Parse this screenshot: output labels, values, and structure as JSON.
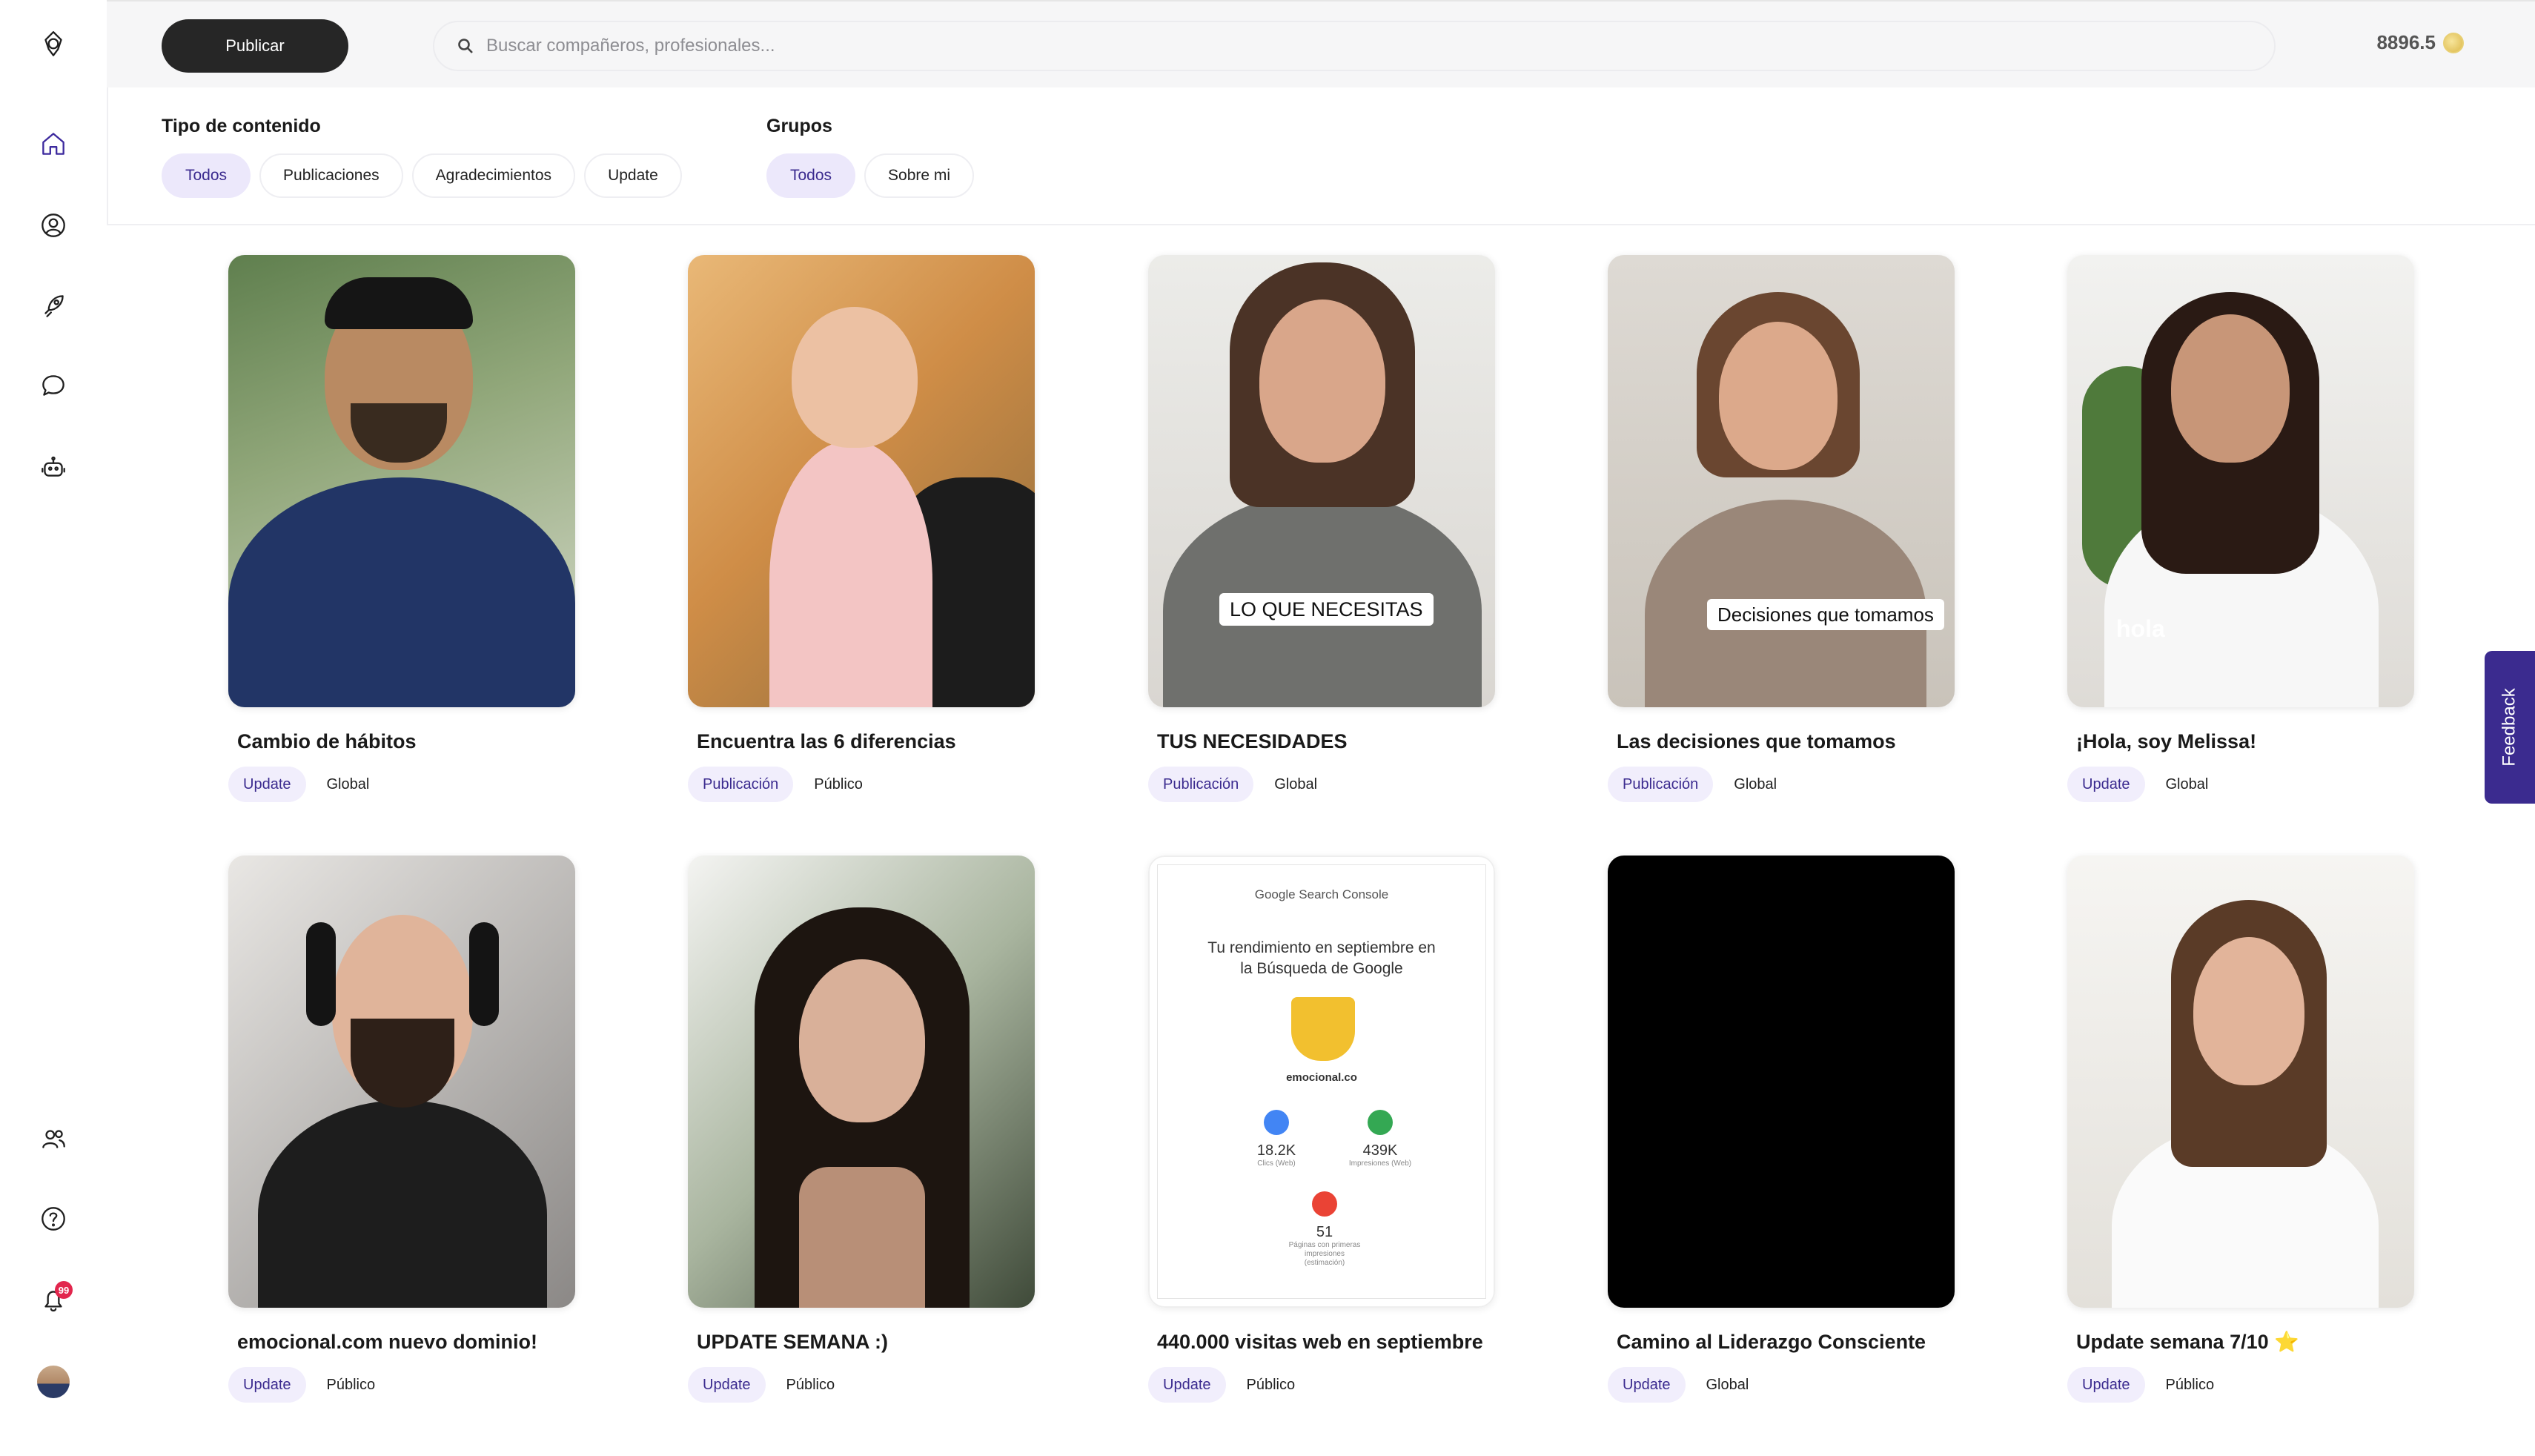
{
  "topbar": {
    "publish_label": "Publicar",
    "search_placeholder": "Buscar compañeros, profesionales...",
    "coins": "8896.5"
  },
  "notifications": {
    "badge": "99"
  },
  "filters": {
    "content_type": {
      "title": "Tipo de contenido",
      "options": [
        "Todos",
        "Publicaciones",
        "Agradecimientos",
        "Update"
      ],
      "selected": "Todos"
    },
    "groups": {
      "title": "Grupos",
      "options": [
        "Todos",
        "Sobre mi"
      ],
      "selected": "Todos"
    }
  },
  "feed": [
    {
      "title": "Cambio de hábitos",
      "type": "Update",
      "scope": "Global"
    },
    {
      "title": "Encuentra las 6 diferencias",
      "type": "Publicación",
      "scope": "Público"
    },
    {
      "title": "TUS NECESIDADES",
      "type": "Publicación",
      "scope": "Global",
      "overlay": "LO QUE NECESITAS"
    },
    {
      "title": "Las decisiones que tomamos",
      "type": "Publicación",
      "scope": "Global",
      "overlay": "Decisiones que tomamos"
    },
    {
      "title": "¡Hola, soy Melissa!",
      "type": "Update",
      "scope": "Global",
      "overlay": "hola"
    },
    {
      "title": "emocional.com nuevo dominio!",
      "type": "Update",
      "scope": "Público"
    },
    {
      "title": "UPDATE SEMANA :)",
      "type": "Update",
      "scope": "Público"
    },
    {
      "title": "440.000 visitas web en septiembre",
      "type": "Update",
      "scope": "Público"
    },
    {
      "title": "Camino al Liderazgo Consciente",
      "type": "Update",
      "scope": "Global"
    },
    {
      "title": "Update semana 7/10 ⭐",
      "type": "Update",
      "scope": "Público"
    }
  ],
  "search_console": {
    "logo": "Google Search Console",
    "headline": "Tu rendimiento en septiembre en la Búsqueda de Google",
    "domain": "emocional.co",
    "stats": [
      {
        "value": "18.2K",
        "label": "Clics (Web)"
      },
      {
        "value": "439K",
        "label": "Impresiones (Web)"
      },
      {
        "value": "51",
        "label": "Páginas con primeras impresiones (estimación)"
      }
    ]
  },
  "feedback_label": "Feedback",
  "colors": {
    "accent": "#3b2b8f",
    "chip_active_bg": "#ece8fb",
    "publish_bg": "#262626"
  }
}
